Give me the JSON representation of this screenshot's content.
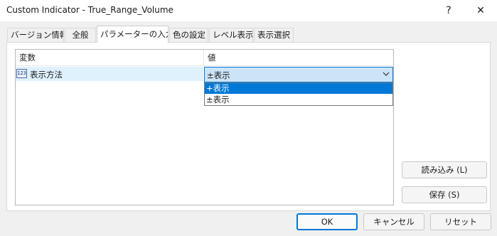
{
  "window": {
    "title": "Custom Indicator - True_Range_Volume",
    "help_label": "?",
    "close_label": "✕"
  },
  "tabs": [
    {
      "label": "バージョン情報",
      "active": false
    },
    {
      "label": "全般",
      "active": false
    },
    {
      "label": "パラメーターの入力",
      "active": true
    },
    {
      "label": "色の設定",
      "active": false
    },
    {
      "label": "レベル表示",
      "active": false
    },
    {
      "label": "表示選択",
      "active": false
    }
  ],
  "params_table": {
    "columns": {
      "variable": "変数",
      "value": "値"
    },
    "rows": [
      {
        "icon": "123",
        "name": "表示方法",
        "value": "±表示"
      }
    ]
  },
  "dropdown": {
    "options": [
      "+表示",
      "±表示"
    ],
    "selected_index": 0
  },
  "side_buttons": {
    "load_label": "読み込み (L)",
    "save_label": "保存 (S)"
  },
  "footer_buttons": {
    "ok_label": "OK",
    "cancel_label": "キャンセル",
    "reset_label": "リセット"
  }
}
